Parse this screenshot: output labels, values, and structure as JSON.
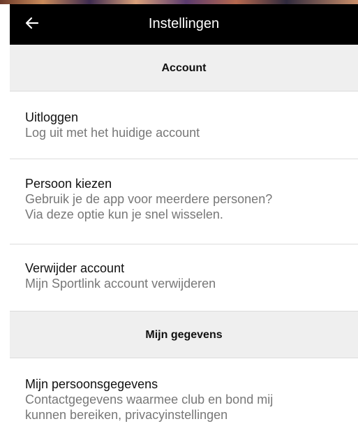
{
  "header": {
    "title": "Instellingen",
    "back_icon": "arrow-left-icon"
  },
  "sections": [
    {
      "title": "Account",
      "items": [
        {
          "title": "Uitloggen",
          "subtitle": "Log uit met het huidige account"
        },
        {
          "title": "Persoon kiezen",
          "subtitle_line1": "Gebruik je de app voor meerdere personen?",
          "subtitle_line2": "Via deze optie kun je snel wisselen."
        },
        {
          "title": "Verwijder account",
          "subtitle": "Mijn Sportlink account verwijderen"
        }
      ]
    },
    {
      "title": "Mijn gegevens",
      "items": [
        {
          "title": "Mijn persoonsgegevens",
          "subtitle_line1": "Contactgegevens waarmee club en bond mij",
          "subtitle_line2": "kunnen bereiken, privacyinstellingen"
        }
      ]
    }
  ],
  "colors": {
    "header_bg": "#000000",
    "section_bg": "#efefef",
    "subtitle_text": "#777777"
  }
}
